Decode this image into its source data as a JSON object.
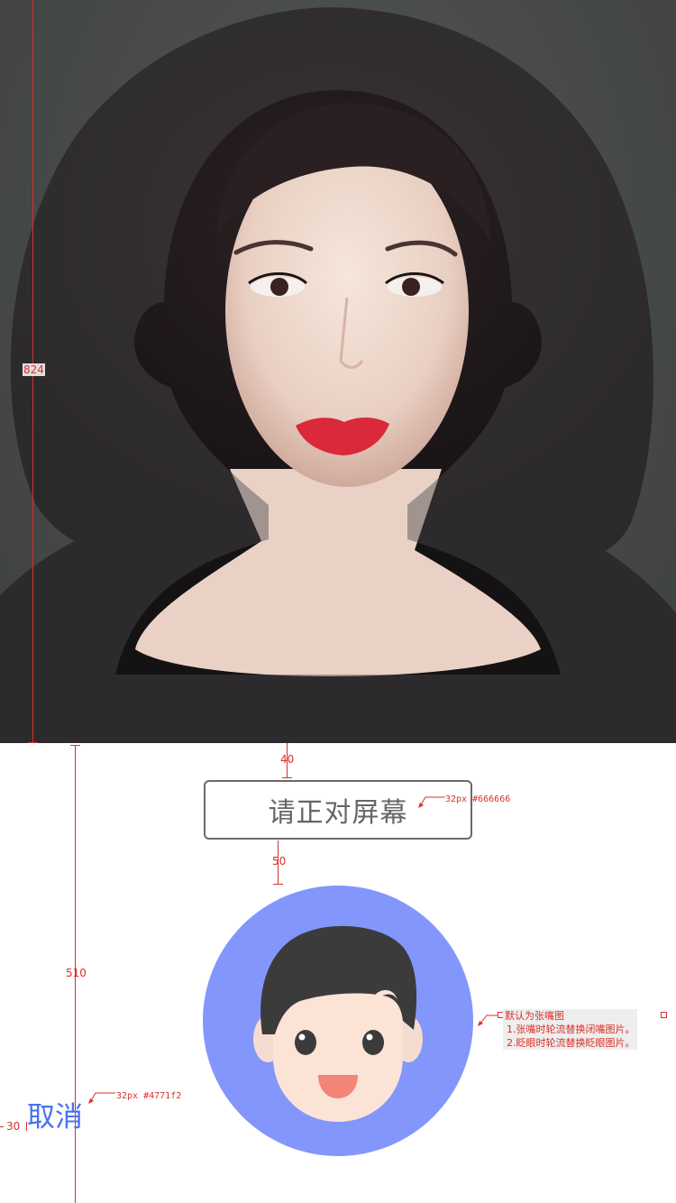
{
  "prompt": {
    "label": "请正对屏幕"
  },
  "cancel": {
    "label": "取消"
  },
  "spec": {
    "camera_height": "824",
    "prompt_top_gap": "40",
    "prompt_avatar_gap": "50",
    "bottom_area_height": "510",
    "cancel_left_margin": "30",
    "prompt_font_note": "32px #666666",
    "cancel_font_note": "32px #4771f2",
    "avatar_note_title": "默认为张嘴图",
    "avatar_note_line1": "1.张嘴时轮流替换闭嘴图片。",
    "avatar_note_line2": "2.眨眼时轮流替换眨眼图片。"
  },
  "colors": {
    "prompt_text": "#666666",
    "cancel_text": "#4771f2",
    "avatar_bg": "#8396fb",
    "annotation": "#d9302a"
  },
  "icons": {
    "avatar": "cartoon-boy-face-icon"
  }
}
